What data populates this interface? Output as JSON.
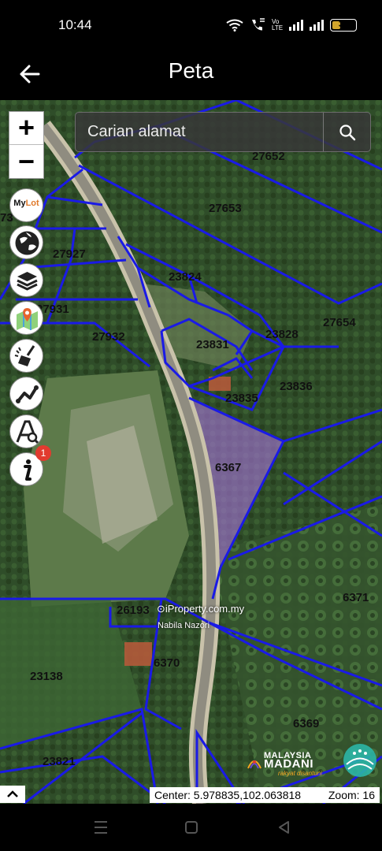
{
  "status": {
    "time": "10:44",
    "volte": "Vo LTE",
    "battery": "36",
    "battery_level": 0.36
  },
  "app": {
    "title": "Peta"
  },
  "map": {
    "search_placeholder": "Carian alamat",
    "zoom_in_label": "+",
    "zoom_out_label": "−",
    "tools": [
      {
        "name": "mylot-button",
        "label_prefix": "My",
        "label_accent": "Lot",
        "icon": "mylot-icon"
      },
      {
        "name": "basemap-button",
        "icon": "globe-icon"
      },
      {
        "name": "layers-button",
        "icon": "layers-icon"
      },
      {
        "name": "location-button",
        "icon": "map-pin-icon"
      },
      {
        "name": "clear-button",
        "icon": "broom-icon"
      },
      {
        "name": "measure-button",
        "icon": "measure-icon"
      },
      {
        "name": "search-lot-button",
        "icon": "text-search-icon"
      },
      {
        "name": "info-button",
        "icon": "info-icon",
        "badge": "1"
      }
    ],
    "lot_labels": {
      "l27652": "27652",
      "l27653": "27653",
      "l73": "73",
      "l27927": "27927",
      "l23824": "23824",
      "l27931": "27931",
      "l27654": "27654",
      "l23828": "23828",
      "l27932": "27932",
      "l23831": "23831",
      "l23836": "23836",
      "l23835": "23835",
      "l6367": "6367",
      "l6371": "6371",
      "l26193": "26193",
      "l6370": "6370",
      "l23138": "23138",
      "l6369": "6369",
      "l23821": "23821"
    },
    "watermark": "iProperty.com.my",
    "watermark_author": "Nabila Nazori",
    "logo": {
      "small": "MALAYSIA",
      "big": "MADANI",
      "tagline": "rakyat disantuni"
    },
    "center_text": "Center: 5.978835,102.063818",
    "zoom_text": "Zoom: 16"
  },
  "colors": {
    "parcel_line": "#1a1ae6",
    "selected_fill": "#7a4bd6",
    "badge": "#e23b2f"
  }
}
